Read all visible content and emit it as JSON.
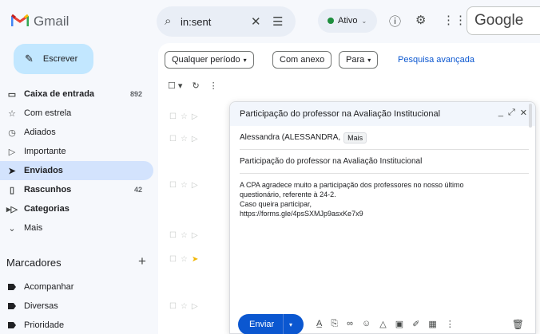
{
  "header": {
    "logo_text": "Gmail",
    "search_query": "in:sent",
    "status_label": "Ativo",
    "google_label": "Google"
  },
  "sidebar": {
    "compose_label": "Escrever",
    "items": [
      {
        "label": "Caixa de entrada",
        "count": "892",
        "bold": true
      },
      {
        "label": "Com estrela"
      },
      {
        "label": "Adiados"
      },
      {
        "label": "Importante"
      },
      {
        "label": "Enviados",
        "active": true
      },
      {
        "label": "Rascunhos",
        "count": "42",
        "bold": true
      },
      {
        "label": "Categorias",
        "bold": true
      },
      {
        "label": "Mais"
      }
    ],
    "labels_title": "Marcadores",
    "labels": [
      "Acompanhar",
      "Diversas",
      "Prioridade"
    ]
  },
  "filters": {
    "chips": [
      "Qualquer período",
      "Com anexo",
      "Para"
    ],
    "advanced": "Pesquisa avançada"
  },
  "popup": {
    "subject": "Participação do professor na Avaliação Institucional",
    "recipient": "Alessandra (ALESSANDRA,",
    "more_chip": "Mais",
    "subject_field": "Participação do professor na Avaliação Institucional",
    "body_lines": [
      "A CPA agradece muito a participação dos professores no nosso último",
      "questionário, referente à 24-2.",
      "Caso queira participar,",
      "https://forms.gle/4psSXMJp9asxKe7x9"
    ],
    "send_label": "Enviar"
  }
}
